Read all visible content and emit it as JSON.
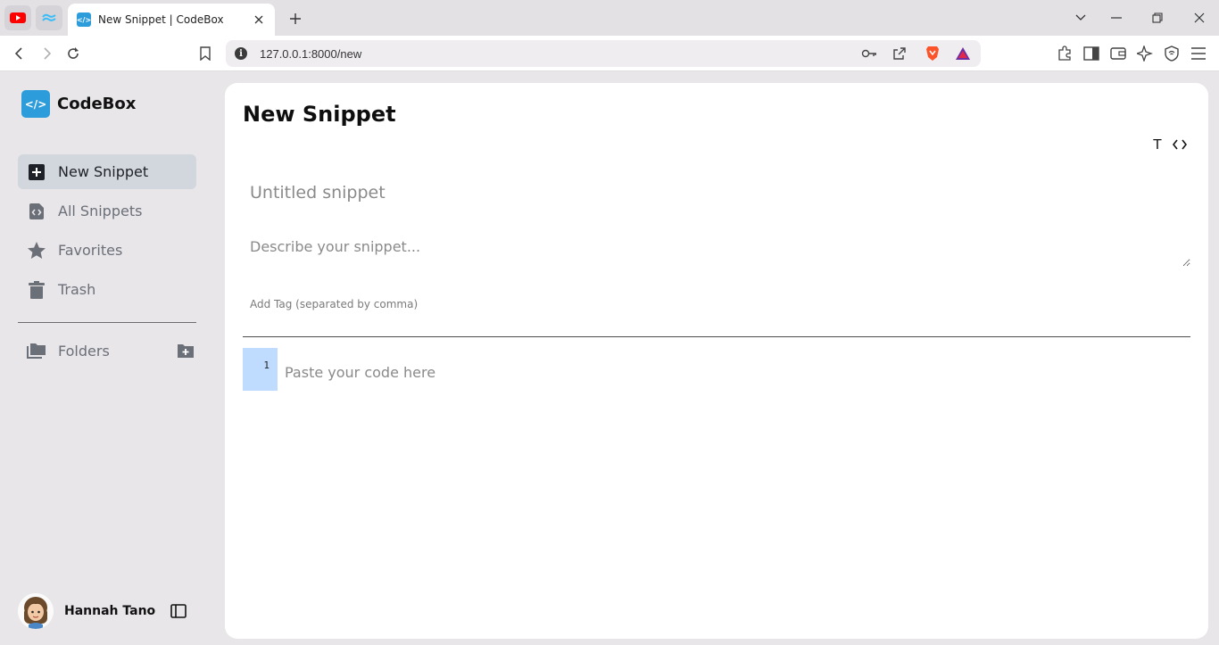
{
  "browser": {
    "tab": {
      "title": "New Snippet | CodeBox",
      "favicon": "</>"
    },
    "address": {
      "url": "127.0.0.1:8000/new",
      "info": "i"
    },
    "colors": {
      "youtube": "#ff0000",
      "tailwind": "#38bdf8",
      "brave": "#fb542b"
    }
  },
  "sidebar": {
    "brand": {
      "logo": "</>",
      "name": "CodeBox"
    },
    "nav": [
      {
        "label": "New Snippet",
        "icon": "plus-square-icon",
        "active": true
      },
      {
        "label": "All Snippets",
        "icon": "code-file-icon",
        "active": false
      },
      {
        "label": "Favorites",
        "icon": "star-icon",
        "active": false
      },
      {
        "label": "Trash",
        "icon": "trash-icon",
        "active": false
      }
    ],
    "folders": {
      "label": "Folders",
      "icon": "folders-icon",
      "add_icon": "folder-add-icon"
    },
    "user": {
      "name": "Hannah Tano"
    }
  },
  "main": {
    "title": "New Snippet",
    "format_toggle": {
      "text_label": "T",
      "code_label": "<>"
    },
    "snippet_title": {
      "placeholder": "Untitled snippet"
    },
    "description": {
      "placeholder": "Describe your snippet..."
    },
    "tags": {
      "placeholder": "Add Tag (separated by comma)"
    },
    "editor": {
      "line_number": "1",
      "placeholder": "Paste your code here"
    },
    "colors": {
      "accent": "#2d9cdb",
      "active_nav": "#d2d6dd",
      "gutter": "#bfdbfe"
    }
  }
}
